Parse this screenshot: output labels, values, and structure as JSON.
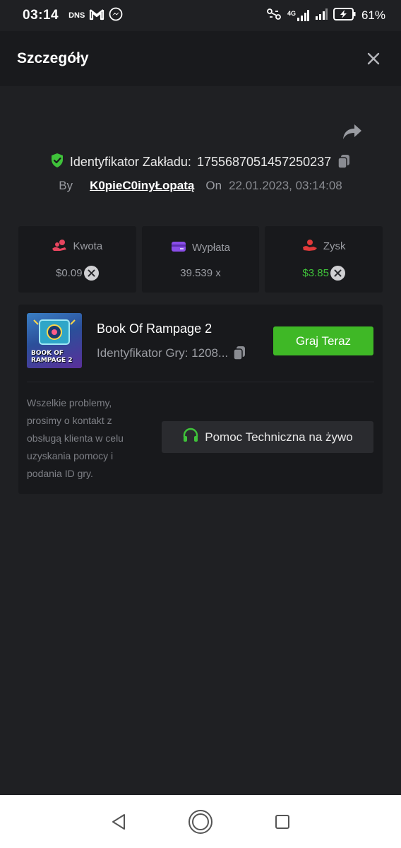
{
  "status_bar": {
    "time": "03:14",
    "dns_label": "DNS",
    "network_label": "4G",
    "battery_percent": "61%"
  },
  "header": {
    "title": "Szczegóły"
  },
  "bet": {
    "id_label": "Identyfikator Zakładu:",
    "id_value": "1755687051457250237",
    "by_label": "By",
    "username": "K0pieC0inyŁopatą",
    "on_label": "On",
    "date": "22.01.2023, 03:14:08"
  },
  "stats": {
    "amount_label": "Kwota",
    "amount_value": "$0.09",
    "payout_label": "Wypłata",
    "payout_value": "39.539 x",
    "profit_label": "Zysk",
    "profit_value": "$3.85"
  },
  "game": {
    "title": "Book Of Rampage 2",
    "id_label": "Identyfikator Gry: 1208...",
    "thumb_caption": "BOOK OF RAMPAGE 2",
    "play_button": "Graj Teraz"
  },
  "support": {
    "help_text": "Wszelkie problemy, prosimy o kontakt z obsługą klienta w celu uzyskania pomocy i podania ID gry.",
    "button_label": "Pomoc Techniczna na żywo"
  },
  "colors": {
    "accent_green": "#3fb826",
    "profit_green": "#3fc23a",
    "background": "#1f2023",
    "card": "#18191c"
  },
  "icons": {
    "close": "close-icon",
    "share": "share-icon",
    "verified": "shield-check-icon",
    "copy": "copy-icon",
    "amount": "coins-icon",
    "payout": "card-icon",
    "profit": "hand-coin-icon",
    "currency": "currency-coin-icon",
    "support": "headset-icon"
  }
}
